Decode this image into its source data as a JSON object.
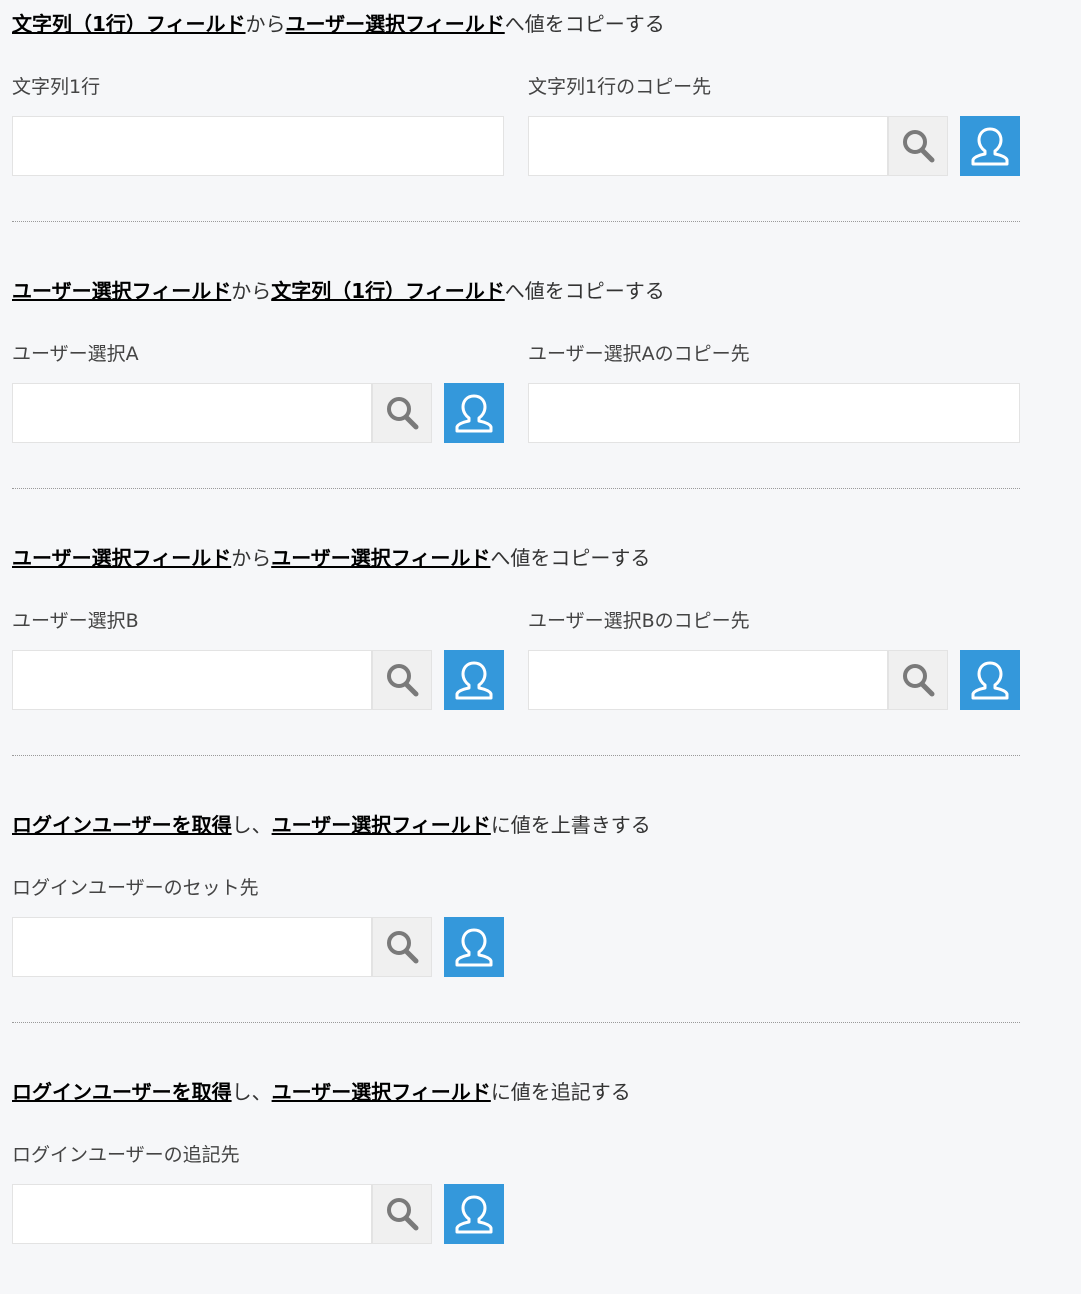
{
  "sections": [
    {
      "heading": {
        "link1": "文字列（1行）フィールド",
        "mid": "から",
        "link2": "ユーザー選択フィールド",
        "tail": "へ値をコピーする"
      },
      "left_label": "文字列1行",
      "right_label": "文字列1行のコピー先"
    },
    {
      "heading": {
        "link1": "ユーザー選択フィールド",
        "mid": "から",
        "link2": "文字列（1行）フィールド",
        "tail": "へ値をコピーする"
      },
      "left_label": "ユーザー選択A",
      "right_label": "ユーザー選択Aのコピー先"
    },
    {
      "heading": {
        "link1": "ユーザー選択フィールド",
        "mid": "から",
        "link2": "ユーザー選択フィールド",
        "tail": "へ値をコピーする"
      },
      "left_label": "ユーザー選択B",
      "right_label": "ユーザー選択Bのコピー先"
    },
    {
      "heading": {
        "link1": "ログインユーザーを取得",
        "mid": "し、",
        "link2": "ユーザー選択フィールド",
        "tail": "に値を上書きする"
      },
      "left_label": "ログインユーザーのセット先"
    },
    {
      "heading": {
        "link1": "ログインユーザーを取得",
        "mid": "し、",
        "link2": "ユーザー選択フィールド",
        "tail": "に値を追記する"
      },
      "left_label": "ログインユーザーの追記先"
    }
  ],
  "icons": {
    "search": "search-icon",
    "user": "user-icon"
  },
  "colors": {
    "background": "#f6f7f9",
    "user_button": "#3498db",
    "search_button": "#f0f0f0",
    "link_text": "#000000"
  }
}
